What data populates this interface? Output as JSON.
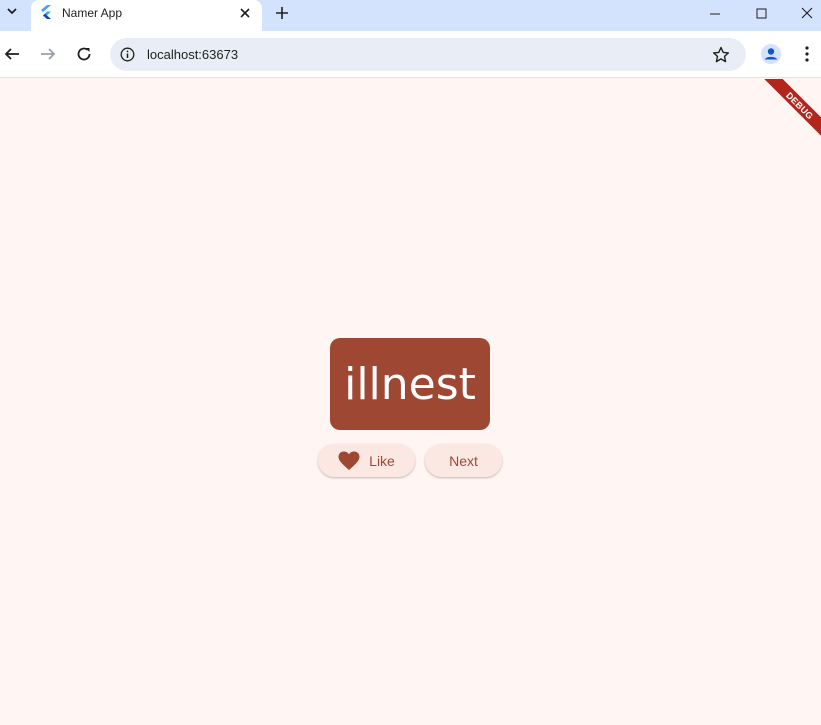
{
  "browser": {
    "tab": {
      "title": "Namer App"
    },
    "address_bar": {
      "url": "localhost:63673"
    },
    "icons": {
      "tab_search": "chevron-down-icon",
      "favicon": "flutter-logo-icon",
      "tab_close": "close-icon",
      "new_tab": "plus-icon",
      "minimize": "minimize-icon",
      "maximize": "maximize-icon",
      "close_window": "close-icon",
      "back": "arrow-left-icon",
      "forward": "arrow-right-icon",
      "reload": "reload-icon",
      "site_info": "info-icon",
      "bookmark": "star-icon",
      "profile": "profile-icon",
      "menu": "more-vert-icon"
    }
  },
  "app": {
    "debug_banner": "DEBUG",
    "word": "illnest",
    "like_button": {
      "label": "Like",
      "icon": "heart-icon"
    },
    "next_button": {
      "label": "Next"
    },
    "colors": {
      "background": "#fff5f2",
      "card": "#9e4733",
      "button_bg": "#fbe8e3",
      "accent": "#9e4733",
      "debug_banner": "#b3261e"
    }
  }
}
